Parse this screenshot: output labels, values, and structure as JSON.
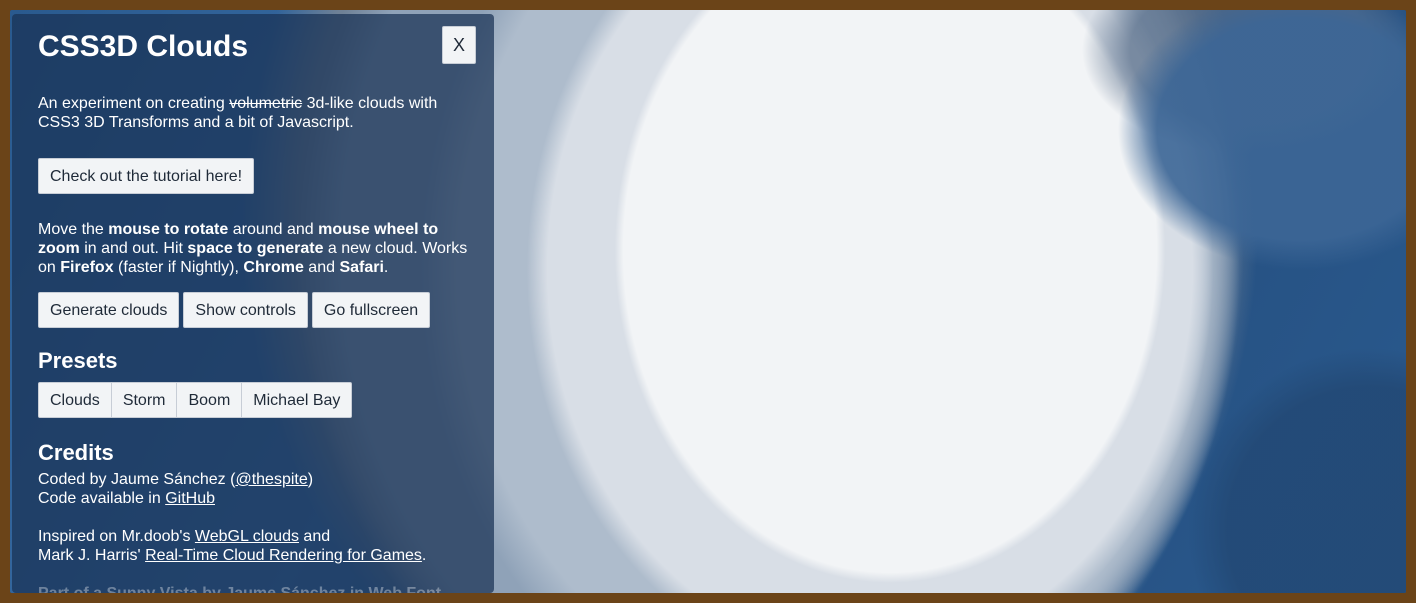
{
  "panel": {
    "title": "CSS3D Clouds",
    "close_label": "X",
    "intro_before": "An experiment on creating ",
    "intro_strike": "volumetric",
    "intro_after": " 3d-like clouds with CSS3 3D Transforms and a bit of Javascript.",
    "tutorial_button": "Check out the tutorial here!",
    "howto": {
      "t1": "Move the ",
      "b1": "mouse to rotate",
      "t2": " around and ",
      "b2": "mouse wheel to zoom",
      "t3": " in and out. Hit ",
      "b3": "space to generate",
      "t4": " a new cloud. Works on ",
      "b4": "Firefox",
      "t5": " (faster if Nightly), ",
      "b5": "Chrome",
      "t6": " and ",
      "b6": "Safari",
      "t7": "."
    },
    "actions": {
      "generate": "Generate clouds",
      "controls": "Show controls",
      "fullscreen": "Go fullscreen"
    },
    "presets_heading": "Presets",
    "presets": [
      "Clouds",
      "Storm",
      "Boom",
      "Michael Bay"
    ],
    "credits_heading": "Credits",
    "credits": {
      "coded_prefix": "Coded by Jaume Sánchez (",
      "coded_link": "@thespite",
      "coded_suffix": ")",
      "code_prefix": "Code available in ",
      "code_link": "GitHub",
      "inspired_prefix": "Inspired on Mr.doob's ",
      "inspired_link1": "WebGL clouds",
      "inspired_mid": " and",
      "harris_prefix": "Mark J. Harris' ",
      "harris_link": "Real-Time Cloud Rendering for Games",
      "harris_suffix": ".",
      "faded_line": "Part of a Sunny Vista by Jaume Sánchez in Web Font"
    }
  },
  "colors": {
    "border": "#6b4418",
    "panel_bg": "#193254",
    "cloud_white": "#f2f4f6",
    "sky_blue": "#2a5a8e"
  }
}
